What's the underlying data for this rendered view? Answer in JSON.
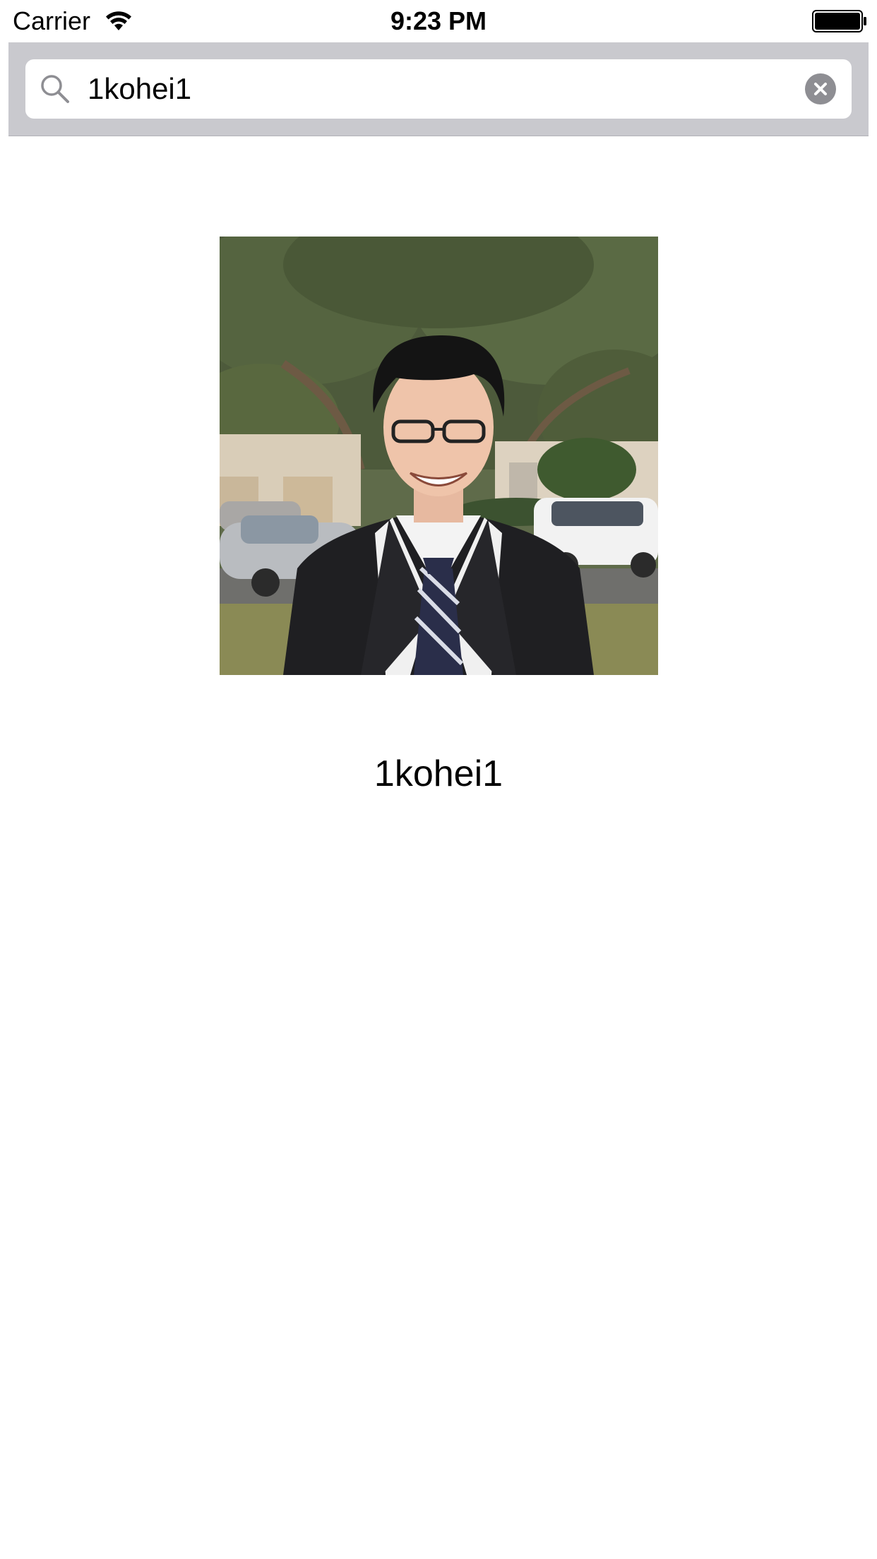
{
  "status_bar": {
    "carrier": "Carrier",
    "time": "9:23 PM"
  },
  "search": {
    "value": "1kohei1"
  },
  "profile": {
    "username": "1kohei1"
  },
  "colors": {
    "search_bar_bg": "#c9c9ce",
    "clear_button": "#8e8e93"
  }
}
